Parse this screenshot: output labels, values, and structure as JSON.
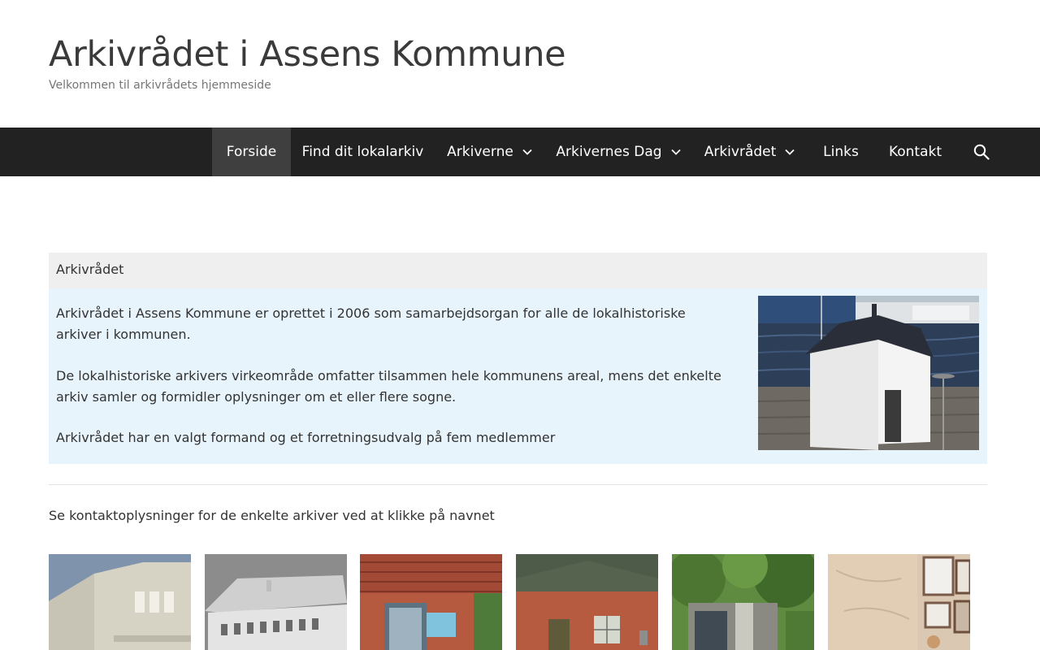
{
  "header": {
    "site_title": "Arkivrådet i Assens Kommune",
    "tagline": "Velkommen til arkivrådets hjemmeside"
  },
  "nav": {
    "items": [
      {
        "label": "Forside",
        "active": true,
        "has_dropdown": false
      },
      {
        "label": "Find dit lokalarkiv",
        "active": false,
        "has_dropdown": false
      },
      {
        "label": "Arkiverne",
        "active": false,
        "has_dropdown": true
      },
      {
        "label": "Arkivernes Dag",
        "active": false,
        "has_dropdown": true
      },
      {
        "label": "Arkivrådet",
        "active": false,
        "has_dropdown": true
      },
      {
        "label": "Links",
        "active": false,
        "has_dropdown": false
      },
      {
        "label": "Kontakt",
        "active": false,
        "has_dropdown": false
      }
    ],
    "search_icon": "search-icon"
  },
  "intro_box": {
    "title": "Arkivrådet",
    "paragraphs": [
      "Arkivrådet i Assens Kommune er oprettet i 2006 som samarbejdsorgan for alle de lokalhistoriske arkiver i kommunen.",
      "De lokalhistoriske arkivers virkeområde omfatter tilsammen hele kommunens areal, mens det enkelte arkiv samler og formidler oplysninger om et eller flere sogne.",
      "Arkivrådet har en valgt formand og et forretningsudvalg på fem medlemmer"
    ]
  },
  "contact_note": "Se kontaktoplysninger for de enkelte arkiver ved at klikke på navnet",
  "colors": {
    "nav_bg": "#222222",
    "nav_active_bg": "#3f3f3f",
    "box_bg": "#e8f4fb",
    "box_header_bg": "#efefef"
  }
}
